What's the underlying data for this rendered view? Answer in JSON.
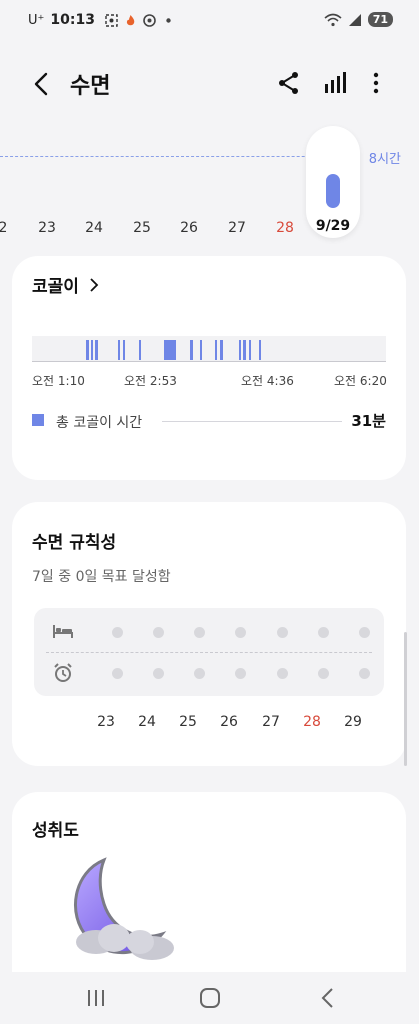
{
  "status_bar": {
    "carrier": "U⁺",
    "time": "10:13",
    "battery": "71",
    "icons": [
      "screenshot-icon",
      "fire-icon",
      "chrome-icon",
      "dot-icon"
    ],
    "right_icons": [
      "wifi-icon",
      "signal-icon"
    ]
  },
  "app_bar": {
    "title": "수면",
    "icons": [
      "back-arrow-icon",
      "share-icon",
      "bar-chart-icon",
      "more-vert-icon"
    ]
  },
  "timeline": {
    "hour_label": "8시간",
    "days": [
      {
        "label": "2",
        "red": false
      },
      {
        "label": "23",
        "red": false
      },
      {
        "label": "24",
        "red": false
      },
      {
        "label": "25",
        "red": false
      },
      {
        "label": "26",
        "red": false
      },
      {
        "label": "27",
        "red": false
      },
      {
        "label": "28",
        "red": true
      }
    ],
    "selected_label": "9/29"
  },
  "snoring": {
    "title": "코골이",
    "time_labels": [
      "오전 1:10",
      "오전 2:53",
      "오전 4:36",
      "오전 6:20"
    ],
    "legend_label": "총 코골이 시간",
    "total": "31분"
  },
  "regularity": {
    "title": "수면 규칙성",
    "subtitle": "7일 중 0일 목표 달성함",
    "days": [
      {
        "label": "23",
        "red": false
      },
      {
        "label": "24",
        "red": false
      },
      {
        "label": "25",
        "red": false
      },
      {
        "label": "26",
        "red": false
      },
      {
        "label": "27",
        "red": false
      },
      {
        "label": "28",
        "red": true
      },
      {
        "label": "29",
        "red": false
      }
    ],
    "row_icons": [
      "bed-icon",
      "alarm-clock-icon"
    ]
  },
  "achievement": {
    "title": "성취도",
    "badge_icon": "moon-cloud-icon"
  },
  "nav_bar": {
    "icons": [
      "recent-apps-icon",
      "home-icon",
      "back-icon"
    ]
  },
  "colors": {
    "accent": "#6f86e6",
    "weekend_red": "#d84a3b",
    "background": "#f4f4f6"
  }
}
